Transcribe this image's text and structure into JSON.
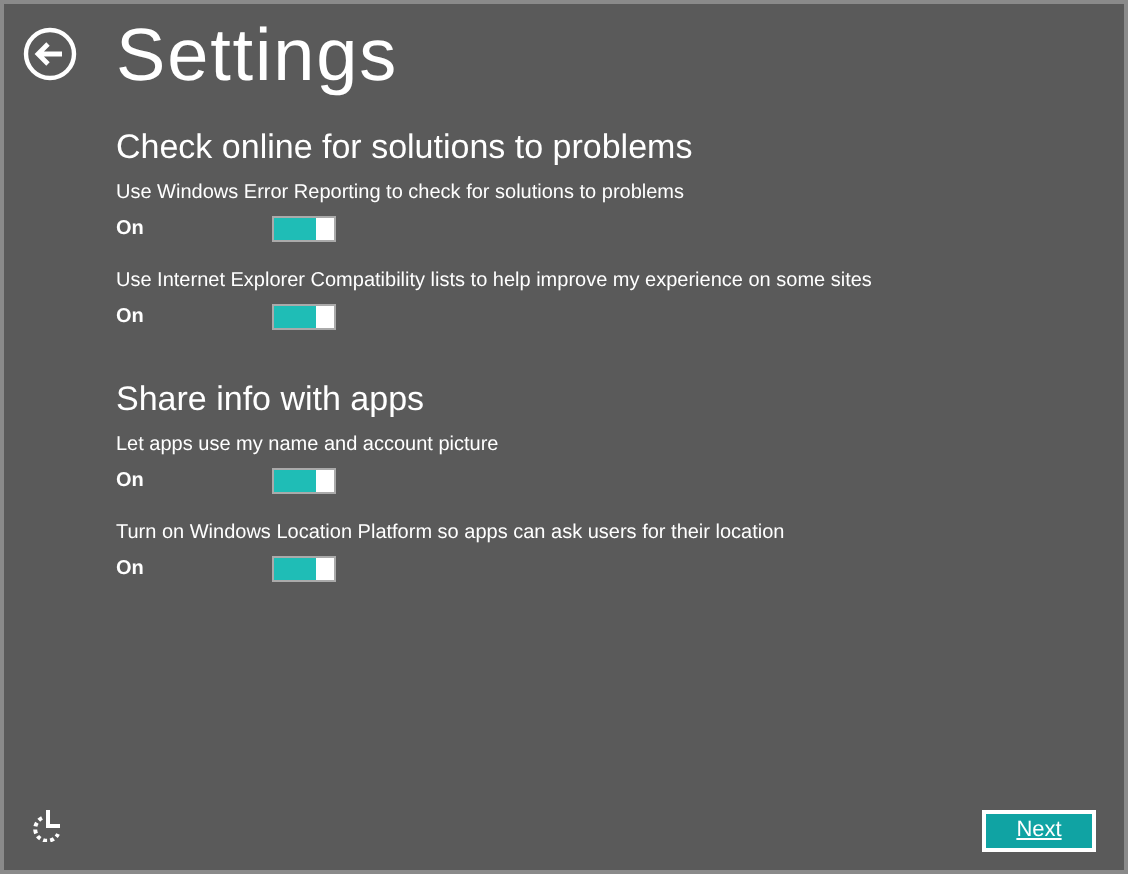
{
  "title": "Settings",
  "sections": [
    {
      "heading": "Check online for solutions to problems",
      "settings": [
        {
          "label": "Use Windows Error Reporting to check for solutions to problems",
          "state": "On",
          "on": true
        },
        {
          "label": "Use Internet Explorer Compatibility lists to help improve my experience on some sites",
          "state": "On",
          "on": true
        }
      ]
    },
    {
      "heading": "Share info with apps",
      "settings": [
        {
          "label": "Let apps use my name and account picture",
          "state": "On",
          "on": true
        },
        {
          "label": "Turn on Windows Location Platform so apps can ask users for their location",
          "state": "On",
          "on": true
        }
      ]
    }
  ],
  "next_button": "Next"
}
